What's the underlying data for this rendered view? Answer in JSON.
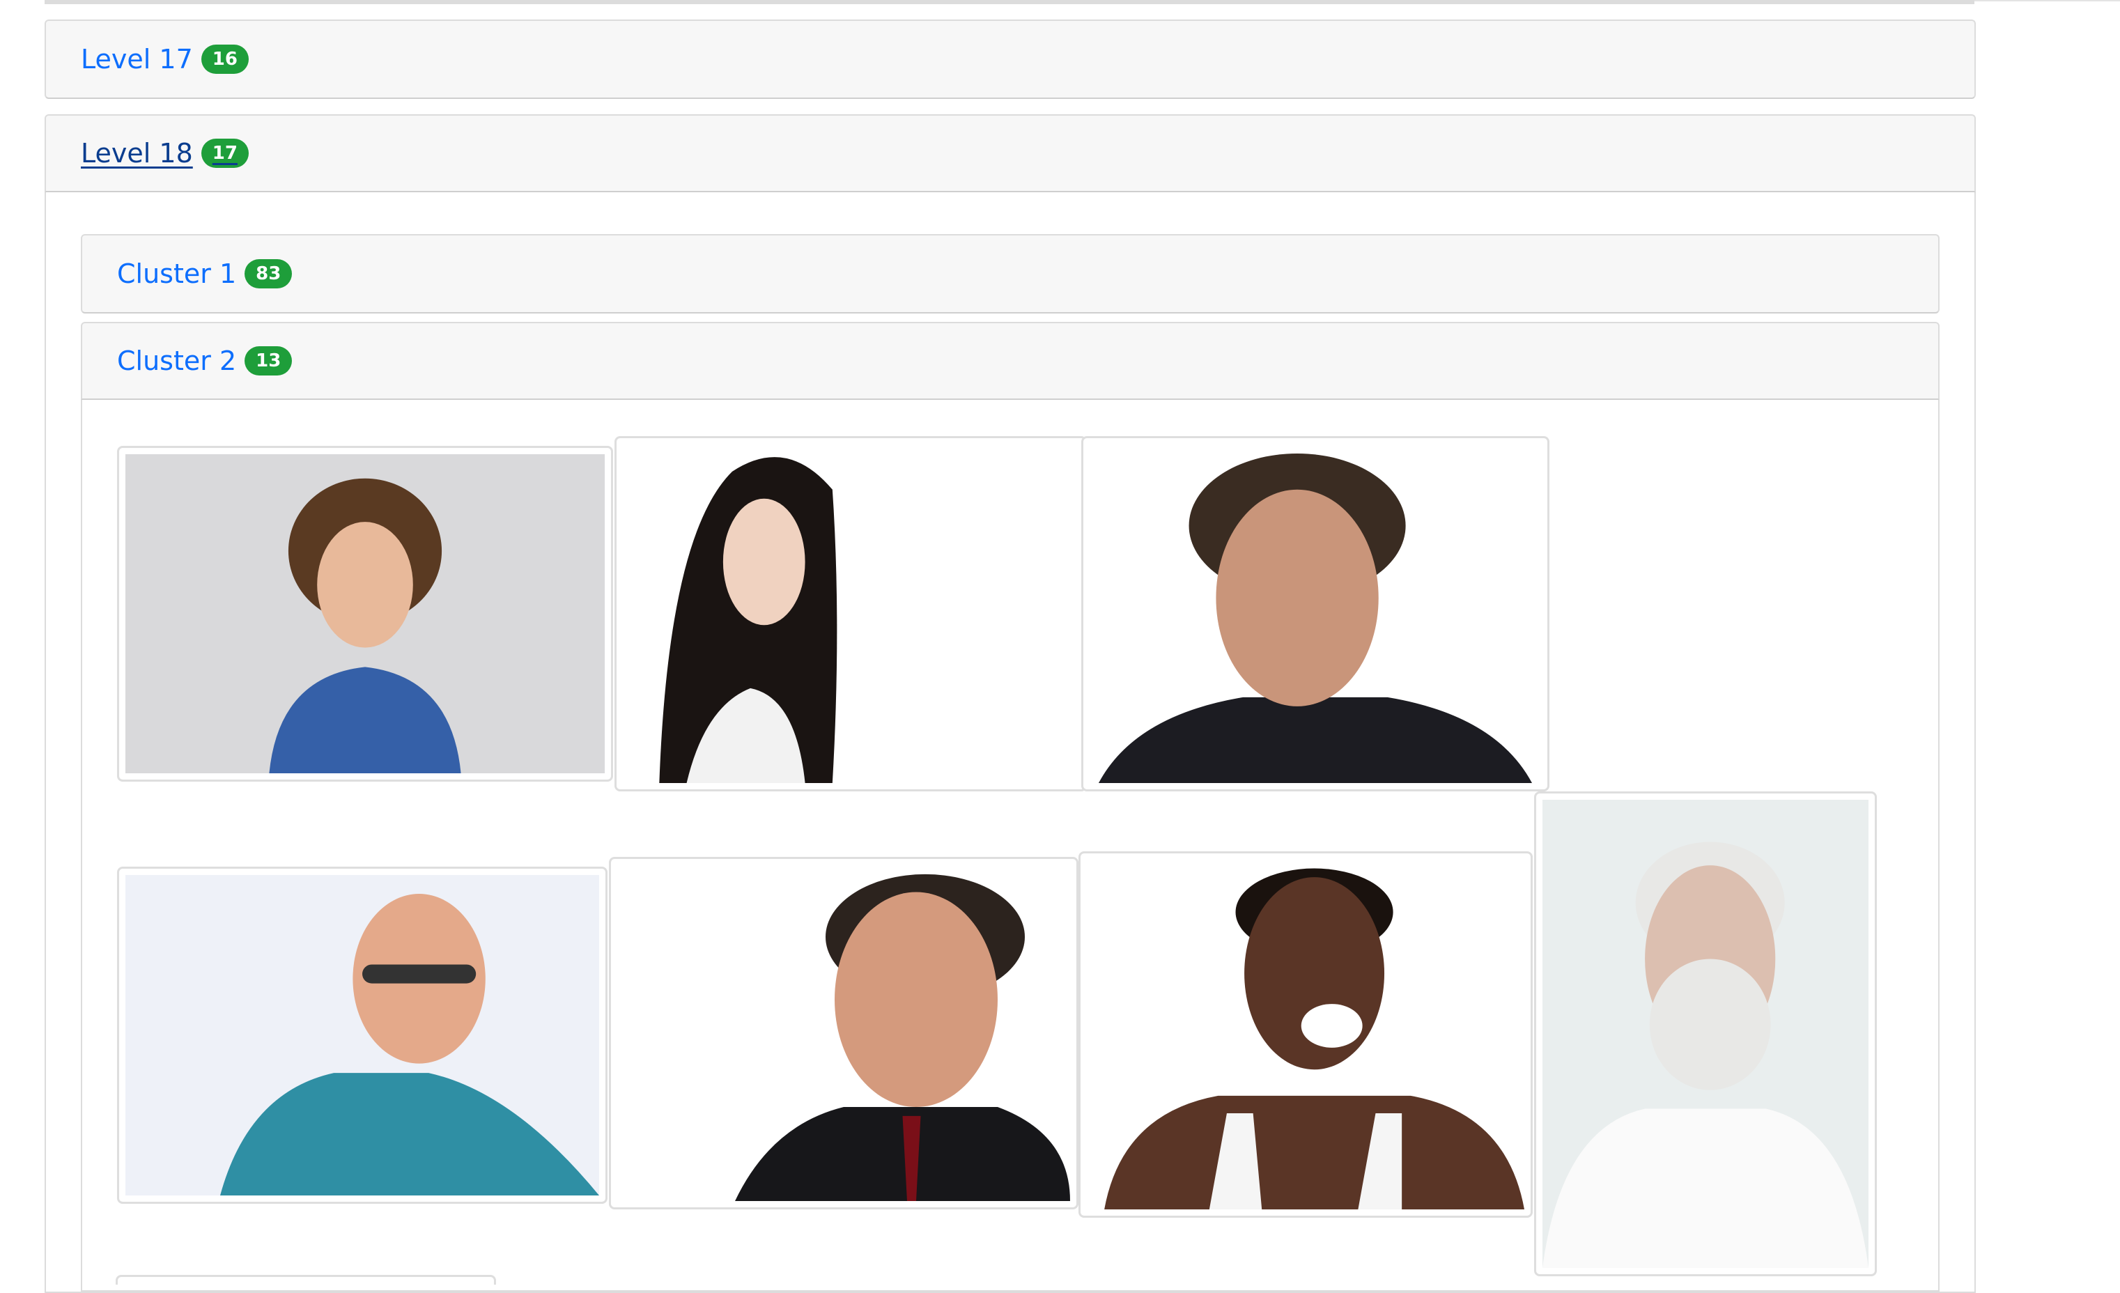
{
  "levels": [
    {
      "label": "Level 17",
      "count": "16"
    },
    {
      "label": "Level 18",
      "count": "17"
    }
  ],
  "clusters": [
    {
      "label": "Cluster 1",
      "count": "83"
    },
    {
      "label": "Cluster 2",
      "count": "13"
    }
  ],
  "photos": [
    {
      "desc": "young man with curly hair in blue sweater",
      "bg": "#d9d9db",
      "skin": "#e8b99a",
      "hair": "#5a3a22",
      "cloth": "#3560a8"
    },
    {
      "desc": "woman with long dark hair in white top",
      "bg": "#ffffff",
      "skin": "#f0d2c0",
      "hair": "#1a1412",
      "cloth": "#f2f2f2"
    },
    {
      "desc": "stubbled man with blue eyes in dark jacket",
      "bg": "#ffffff",
      "skin": "#c9957a",
      "hair": "#3a2c22",
      "cloth": "#1c1c22"
    },
    {
      "desc": "bald man with glasses in striped shirt",
      "bg": "#eef1f8",
      "skin": "#e4a98a",
      "hair": "#c88a70",
      "cloth": "#2f8fa4"
    },
    {
      "desc": "bearded man in suit and red tie",
      "bg": "#ffffff",
      "skin": "#d49a7d",
      "hair": "#2c231e",
      "cloth": "#17171a"
    },
    {
      "desc": "smiling woman with short hair in white tank top",
      "bg": "#ffffff",
      "skin": "#5a3526",
      "hair": "#1a120e",
      "cloth": "#f5f5f5"
    },
    {
      "desc": "man with white hair and white beard in white t-shirt",
      "bg": "#e9eeee",
      "skin": "#dcbfb0",
      "hair": "#e8e8e6",
      "cloth": "#fafafa"
    }
  ]
}
